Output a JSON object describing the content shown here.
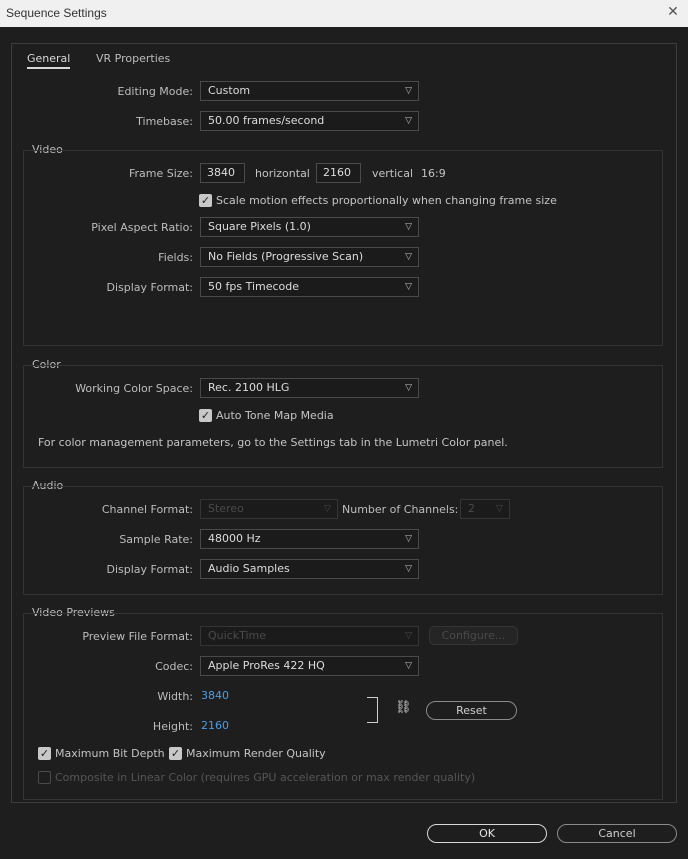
{
  "window": {
    "title": "Sequence Settings"
  },
  "tabs": [
    {
      "label": "General"
    },
    {
      "label": "VR Properties"
    }
  ],
  "general": {
    "editing_mode": {
      "label": "Editing Mode:",
      "value": "Custom"
    },
    "timebase": {
      "label": "Timebase:",
      "value": "50.00  frames/second"
    }
  },
  "video": {
    "title": "Video",
    "frame_size": {
      "label": "Frame Size:",
      "width": "3840",
      "horizontal_label": "horizontal",
      "height": "2160",
      "vertical_label": "vertical",
      "aspect": "16:9"
    },
    "scale_motion": {
      "label": "Scale motion effects proportionally when changing frame size",
      "checked": true
    },
    "pixel_aspect": {
      "label": "Pixel Aspect Ratio:",
      "value": "Square Pixels (1.0)"
    },
    "fields": {
      "label": "Fields:",
      "value": "No Fields (Progressive Scan)"
    },
    "display_format": {
      "label": "Display Format:",
      "value": "50 fps Timecode"
    }
  },
  "color": {
    "title": "Color",
    "working_space": {
      "label": "Working Color Space:",
      "value": "Rec. 2100 HLG"
    },
    "auto_tone": {
      "label": "Auto Tone Map Media",
      "checked": true
    },
    "note": "For color management parameters, go to the Settings tab in the Lumetri Color panel."
  },
  "audio": {
    "title": "Audio",
    "channel_format": {
      "label": "Channel Format:",
      "value": "Stereo"
    },
    "num_channels": {
      "label": "Number of Channels:",
      "value": "2"
    },
    "sample_rate": {
      "label": "Sample Rate:",
      "value": "48000 Hz"
    },
    "display_format": {
      "label": "Display Format:",
      "value": "Audio Samples"
    }
  },
  "previews": {
    "title": "Video Previews",
    "file_format": {
      "label": "Preview File Format:",
      "value": "QuickTime"
    },
    "configure": "Configure...",
    "codec": {
      "label": "Codec:",
      "value": "Apple ProRes 422 HQ"
    },
    "width": {
      "label": "Width:",
      "value": "3840"
    },
    "height": {
      "label": "Height:",
      "value": "2160"
    },
    "reset": "Reset",
    "max_bit_depth": {
      "label": "Maximum Bit Depth",
      "checked": true
    },
    "max_render_quality": {
      "label": "Maximum Render Quality",
      "checked": true
    },
    "linear_color": {
      "label": "Composite in Linear Color (requires GPU acceleration or max render quality)",
      "checked": false
    }
  },
  "footer": {
    "ok": "OK",
    "cancel": "Cancel"
  },
  "icons": {
    "close": "close-icon",
    "chevron": "chevron-down-icon",
    "link": "link-icon",
    "check": "checkmark-icon"
  }
}
